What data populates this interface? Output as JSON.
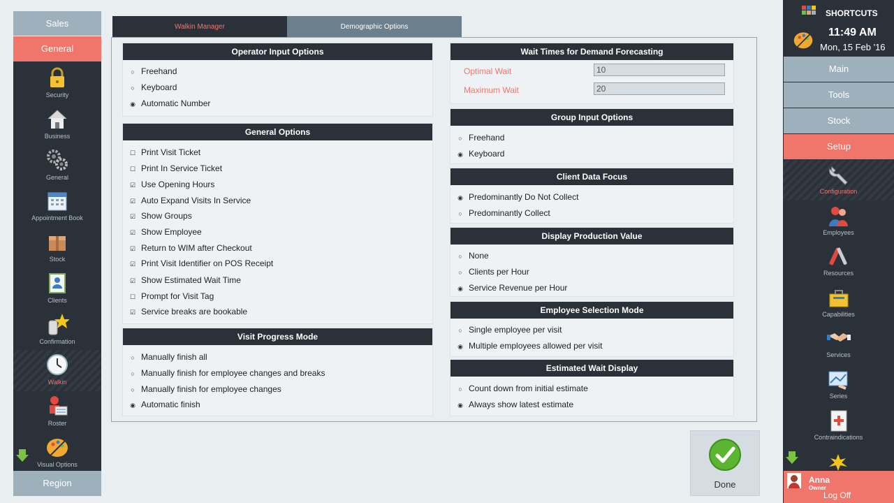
{
  "left_nav": {
    "top_label": "Sales",
    "general_label": "General",
    "items": [
      {
        "label": "Security",
        "icon": "lock-icon"
      },
      {
        "label": "Business",
        "icon": "house-icon"
      },
      {
        "label": "General",
        "icon": "gears-icon"
      },
      {
        "label": "Appointment Book",
        "icon": "calendar-icon"
      },
      {
        "label": "Stock",
        "icon": "box-icon"
      },
      {
        "label": "Clients",
        "icon": "client-card-icon"
      },
      {
        "label": "Confirmation",
        "icon": "phone-star-icon"
      },
      {
        "label": "Walkin",
        "icon": "clock-icon"
      },
      {
        "label": "Roster",
        "icon": "roster-icon"
      },
      {
        "label": "Visual Options",
        "icon": "palette-icon"
      }
    ],
    "bottom_label": "Region"
  },
  "tabs": [
    "Walkin Manager",
    "Demographic Options"
  ],
  "operator_input": {
    "title": "Operator Input Options",
    "options": [
      "Freehand",
      "Keyboard",
      "Automatic Number"
    ],
    "selected": 2
  },
  "general_options": {
    "title": "General Options",
    "items": [
      {
        "label": "Print Visit Ticket",
        "checked": false
      },
      {
        "label": "Print In Service Ticket",
        "checked": false
      },
      {
        "label": "Use Opening Hours",
        "checked": true
      },
      {
        "label": "Auto Expand Visits In Service",
        "checked": true
      },
      {
        "label": "Show Groups",
        "checked": true
      },
      {
        "label": "Show Employee",
        "checked": true
      },
      {
        "label": "Return to WIM after Checkout",
        "checked": true
      },
      {
        "label": "Print Visit Identifier on POS Receipt",
        "checked": true
      },
      {
        "label": "Show Estimated Wait Time",
        "checked": true
      },
      {
        "label": "Prompt for Visit Tag",
        "checked": false
      },
      {
        "label": "Service breaks are bookable",
        "checked": true
      }
    ]
  },
  "visit_progress": {
    "title": "Visit Progress Mode",
    "options": [
      "Manually finish all",
      "Manually finish for employee changes and breaks",
      "Manually finish for employee changes",
      "Automatic finish"
    ],
    "selected": 3
  },
  "wait_times": {
    "title": "Wait Times for Demand Forecasting",
    "optimal_label": "Optimal Wait",
    "optimal_value": "10",
    "maximum_label": "Maximum Wait",
    "maximum_value": "20"
  },
  "group_input": {
    "title": "Group Input Options",
    "options": [
      "Freehand",
      "Keyboard"
    ],
    "selected": 1
  },
  "client_data": {
    "title": "Client Data Focus",
    "options": [
      "Predominantly Do Not Collect",
      "Predominantly Collect"
    ],
    "selected": 0
  },
  "production_value": {
    "title": "Display Production Value",
    "options": [
      "None",
      "Clients per Hour",
      "Service Revenue per Hour"
    ],
    "selected": 2
  },
  "employee_selection": {
    "title": "Employee Selection Mode",
    "options": [
      "Single employee per visit",
      "Multiple employees allowed per visit"
    ],
    "selected": 1
  },
  "estimated_wait": {
    "title": "Estimated Wait Display",
    "options": [
      "Count down from initial estimate",
      "Always show latest estimate"
    ],
    "selected": 1
  },
  "done_label": "Done",
  "right_nav": {
    "shortcuts_label": "SHORTCUTS",
    "time": "11:49 AM",
    "date": "Mon, 15 Feb '16",
    "main_label": "Main",
    "tools_label": "Tools",
    "stock_label": "Stock",
    "setup_label": "Setup",
    "items": [
      {
        "label": "Configuration",
        "icon": "wrench-icon"
      },
      {
        "label": "Employees",
        "icon": "employees-icon"
      },
      {
        "label": "Resources",
        "icon": "tools-icon"
      },
      {
        "label": "Capabilities",
        "icon": "toolbox-icon"
      },
      {
        "label": "Services",
        "icon": "handshake-icon"
      },
      {
        "label": "Series",
        "icon": "series-icon"
      },
      {
        "label": "Contraindications",
        "icon": "medical-icon"
      }
    ],
    "user_name": "Anna",
    "user_role": "Owner",
    "logoff_label": "Log Off"
  },
  "colors": {
    "accent": "#f0766b",
    "dark": "#2b3138",
    "slate": "#9fb0bd",
    "bg": "#e9eef1"
  }
}
